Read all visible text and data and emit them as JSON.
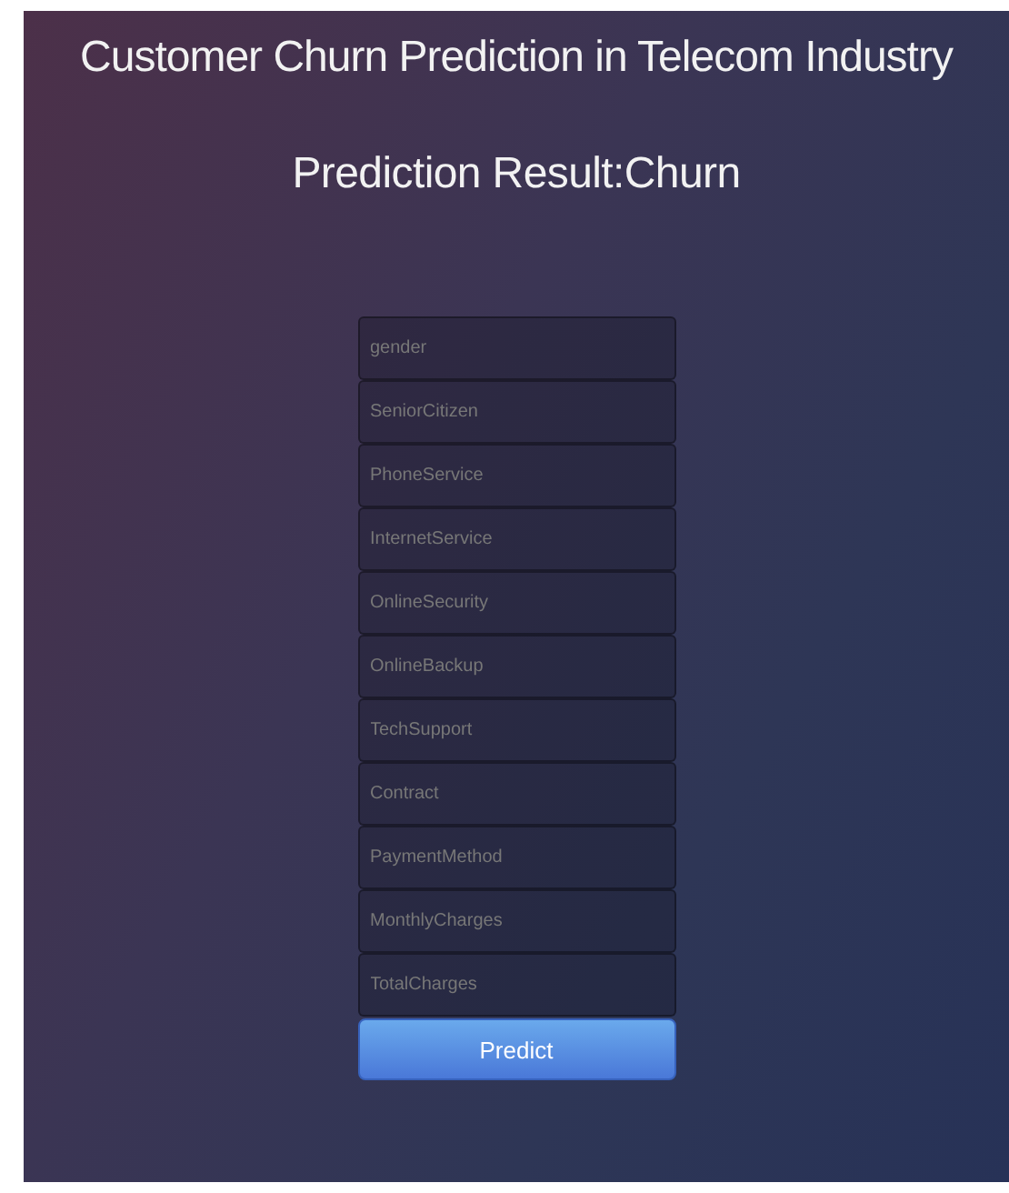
{
  "title": "Customer Churn Prediction in Telecom Industry",
  "result": "Prediction Result:Churn",
  "fields": [
    {
      "placeholder": "gender"
    },
    {
      "placeholder": "SeniorCitizen"
    },
    {
      "placeholder": "PhoneService"
    },
    {
      "placeholder": "InternetService"
    },
    {
      "placeholder": "OnlineSecurity"
    },
    {
      "placeholder": "OnlineBackup"
    },
    {
      "placeholder": "TechSupport"
    },
    {
      "placeholder": "Contract"
    },
    {
      "placeholder": "PaymentMethod"
    },
    {
      "placeholder": "MonthlyCharges"
    },
    {
      "placeholder": "TotalCharges"
    }
  ],
  "button": "Predict"
}
